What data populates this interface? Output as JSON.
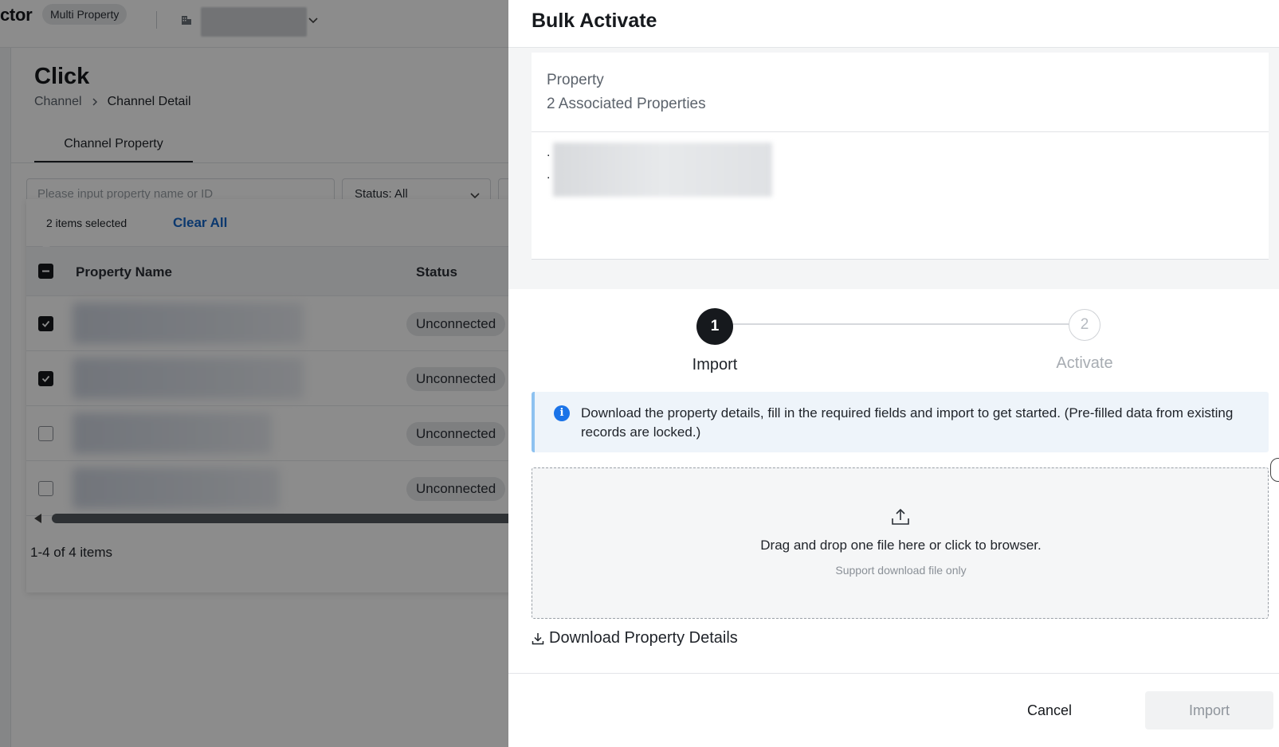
{
  "app": {
    "brand_fragment": "ctor",
    "mode_badge": "Multi Property",
    "icons": {
      "building": "building-icon",
      "chevron": "chevron-down-icon"
    }
  },
  "page": {
    "title": "Click",
    "breadcrumb": [
      "Channel",
      "Channel Detail"
    ],
    "tabs": [
      {
        "label": "Channel Property",
        "active": true
      }
    ],
    "search_placeholder": "Please input property name or ID",
    "status_filter": "Status: All"
  },
  "selection": {
    "count_text": "2 items selected",
    "clear_label": "Clear All"
  },
  "table": {
    "columns": [
      "Property Name",
      "Status"
    ],
    "rows": [
      {
        "checked": true,
        "status": "Unconnected"
      },
      {
        "checked": true,
        "status": "Unconnected"
      },
      {
        "checked": false,
        "status": "Unconnected"
      },
      {
        "checked": false,
        "status": "Unconnected"
      }
    ],
    "pager_text": "1-4 of 4 items"
  },
  "drawer": {
    "title": "Bulk Activate",
    "property_label": "Property",
    "property_count": "2 Associated Properties",
    "property_bullets": [
      ".",
      "."
    ],
    "steps": [
      {
        "number": "1",
        "label": "Import",
        "active": true
      },
      {
        "number": "2",
        "label": "Activate",
        "active": false
      }
    ],
    "info_text": "Download the property details, fill in the required fields and import to get started. (Pre-filled data from existing records are locked.)",
    "dropzone_main": "Drag and drop one file here or click to browser.",
    "dropzone_sub": "Support download file only",
    "download_link": "Download Property Details",
    "cancel_label": "Cancel",
    "import_label": "Import",
    "accent_color": "#16191d",
    "info_color": "#1a73e8"
  }
}
